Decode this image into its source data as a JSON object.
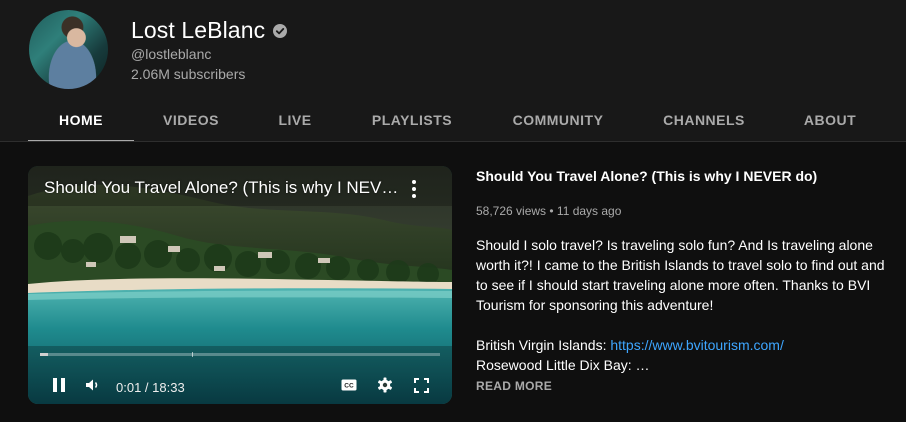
{
  "channel": {
    "name": "Lost LeBlanc",
    "handle": "@lostleblanc",
    "subscribers": "2.06M subscribers",
    "verified": true
  },
  "tabs": [
    {
      "label": "HOME",
      "active": true
    },
    {
      "label": "VIDEOS",
      "active": false
    },
    {
      "label": "LIVE",
      "active": false
    },
    {
      "label": "PLAYLISTS",
      "active": false
    },
    {
      "label": "COMMUNITY",
      "active": false
    },
    {
      "label": "CHANNELS",
      "active": false
    },
    {
      "label": "ABOUT",
      "active": false
    }
  ],
  "player": {
    "overlay_title": "Should You Travel Alone? (This is why I NEVER do)",
    "current_time": "0:01",
    "duration": "18:33",
    "time_display": "0:01 / 18:33",
    "progress_fraction": 0.001,
    "icons": [
      "pause-icon",
      "volume-icon",
      "captions-icon",
      "settings-icon",
      "fullscreen-icon",
      "more-vert-icon"
    ]
  },
  "featured_video": {
    "title": "Should You Travel Alone? (This is why I NEVER do)",
    "meta": "58,726 views • 11 days ago",
    "description_lines": [
      "Should I solo travel?  Is traveling solo fun? And Is traveling alone worth it?! I came to the British Islands to travel solo to find out and to see if I should start traveling alone more often. Thanks to BVI Tourism for sponsoring this adventure!"
    ],
    "bvi_label": "British Virgin Islands: ",
    "bvi_link": "https://www.bvitourism.com/",
    "rosewood": "Rosewood Little Dix Bay: …",
    "read_more": "READ MORE"
  },
  "colors": {
    "background": "#0f0f0f",
    "header_background": "#181818",
    "link": "#3ea6ff",
    "secondary_text": "#aaaaaa"
  }
}
